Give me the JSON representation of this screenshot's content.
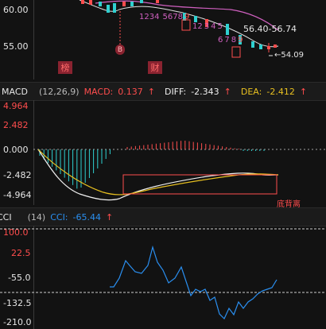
{
  "price_panel": {
    "y_labels": [
      "60.00",
      "55.00"
    ],
    "range_text": "56.40-56.74",
    "low_text": "54.09",
    "b_marker": "B",
    "tags": [
      "榜",
      "财"
    ],
    "seq_top": [
      "1",
      "2",
      "3",
      "4",
      "5",
      "6",
      "7",
      "8",
      "9"
    ],
    "seq_mid": [
      "1",
      "2",
      "3",
      "4",
      "5"
    ],
    "seq_low": [
      "6",
      "7",
      "8",
      "9"
    ]
  },
  "macd_header": {
    "name": "MACD",
    "params": "(12,26,9)",
    "macd_label": "MACD:",
    "macd_value": "0.137",
    "diff_label": "DIFF:",
    "diff_value": "-2.343",
    "dea_label": "DEA:",
    "dea_value": "-2.412"
  },
  "macd_panel": {
    "y_labels": [
      "4.964",
      "2.482",
      "0.000",
      "-2.482",
      "-4.964"
    ],
    "divergence_label": "底背离"
  },
  "cci_header": {
    "name": "CCI",
    "params": "(14)",
    "cci_label": "CCI:",
    "cci_value": "-65.44"
  },
  "cci_panel": {
    "y_labels": [
      "100.0",
      "22.5",
      "-55.0",
      "-132.5",
      "-210.0"
    ]
  },
  "colors": {
    "up": "#ff4d4d",
    "down": "#2fd0d0",
    "diff_line": "#f0f0f0",
    "dea_line": "#e8c020",
    "cci_line": "#2a8ff0",
    "ma_line": "#d060c0"
  }
}
